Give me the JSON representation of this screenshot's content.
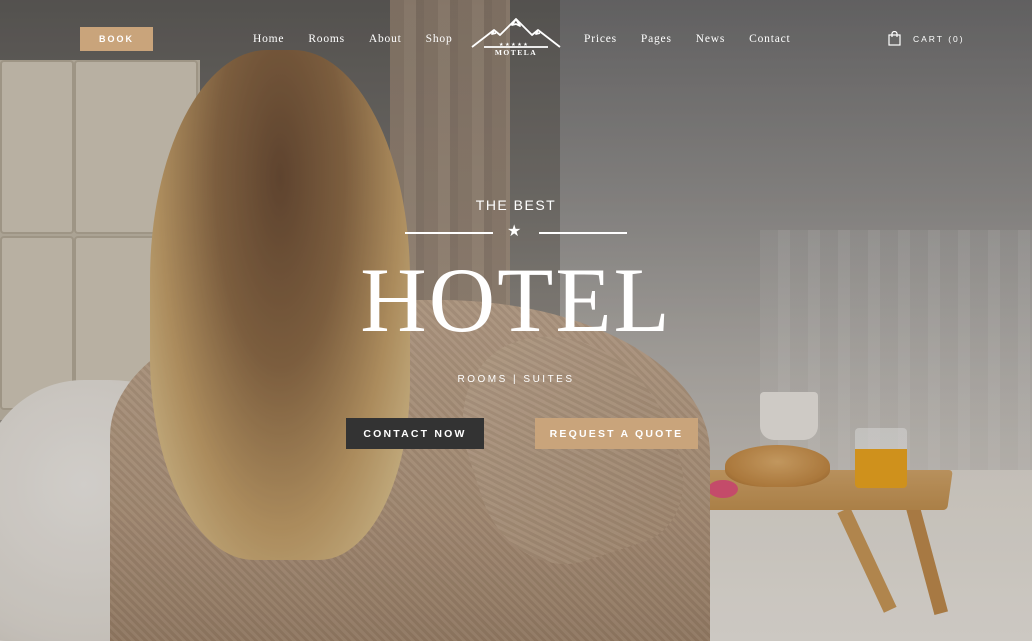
{
  "header": {
    "book_label": "BOOK",
    "nav_left": [
      "Home",
      "Rooms",
      "About",
      "Shop"
    ],
    "nav_right": [
      "Prices",
      "Pages",
      "News",
      "Contact"
    ],
    "logo_text": "MOTELA",
    "cart_label": "CART (0)"
  },
  "hero": {
    "subtitle": "THE BEST",
    "star": "★",
    "title": "HOTEL",
    "tagline": "ROOMS | SUITES",
    "cta_primary": "CONTACT NOW",
    "cta_secondary": "REQUEST A QUOTE"
  },
  "colors": {
    "accent": "#c9a47b",
    "dark_button": "#333333",
    "text": "#ffffff"
  },
  "icons": {
    "logo": "mountain-logo-icon",
    "cart": "shopping-bag-icon",
    "divider_star": "star-icon"
  }
}
